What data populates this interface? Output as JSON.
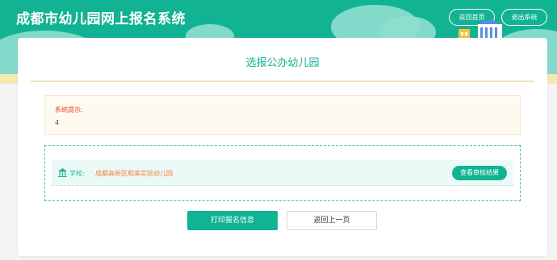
{
  "header": {
    "title": "成都市幼儿园网上报名系统",
    "home_label": "返回首页",
    "logout_label": "退出系统"
  },
  "page": {
    "title": "选报公办幼儿园"
  },
  "notice": {
    "label": "系统提示:",
    "value": "4"
  },
  "school": {
    "icon": "institution-icon",
    "label": "学校:",
    "name": "成都高新区和美实验幼儿园",
    "review_label": "查看审核结果"
  },
  "actions": {
    "print_label": "打印报名信息",
    "back_label": "返回上一页"
  },
  "colors": {
    "brand": "#12b393",
    "accent_yellow": "#f3e9b2",
    "notice_red": "#e5432c",
    "school_orange": "#f08040"
  }
}
